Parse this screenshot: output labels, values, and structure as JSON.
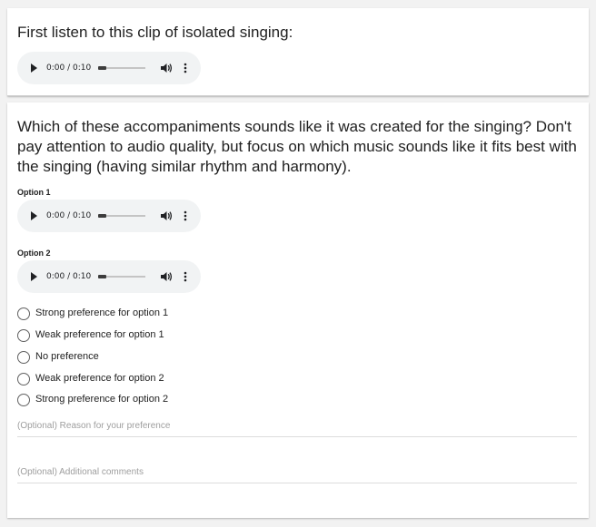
{
  "intro": {
    "text": "First listen to this clip of isolated singing:",
    "player": {
      "time": "0:00 / 0:10",
      "progress": 0.0
    }
  },
  "question": {
    "text": "Which of these accompaniments sounds like it was created for the singing? Don't pay attention to audio quality, but focus on which music sounds like it fits best with the singing (having similar rhythm and harmony).",
    "options": [
      {
        "label": "Option 1",
        "time": "0:00 / 0:10"
      },
      {
        "label": "Option 2",
        "time": "0:00 / 0:10"
      }
    ],
    "choices": [
      "Strong preference for option 1",
      "Weak preference for option 1",
      "No preference",
      "Weak preference for option 2",
      "Strong preference for option 2"
    ],
    "reason_placeholder": "(Optional) Reason for your preference",
    "comments_placeholder": "(Optional) Additional comments"
  },
  "icons": {
    "play": "play-icon",
    "volume": "volume-icon",
    "more": "more-vert-icon"
  }
}
